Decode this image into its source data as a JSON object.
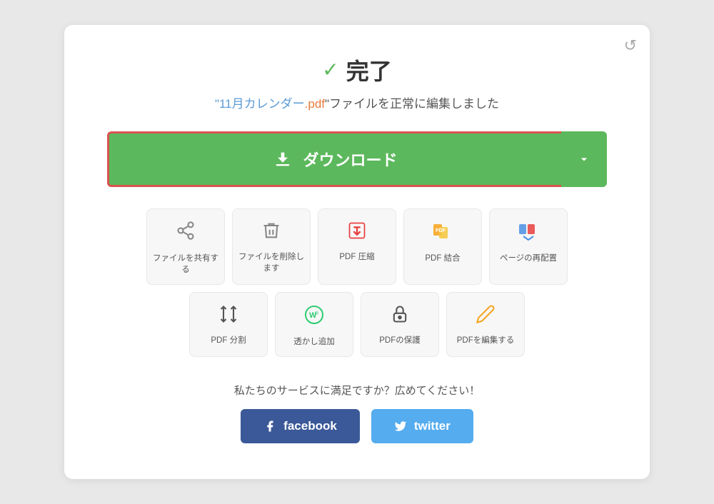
{
  "refresh_icon": "↺",
  "title": {
    "check": "✓",
    "label": "完了",
    "subtitle_prefix": "\"11月カレンダー",
    "subtitle_ext": ".pdf",
    "subtitle_suffix": "\"ファイルを正常に編集しました"
  },
  "download_button": {
    "label": "ダウンロード",
    "chevron": "∨"
  },
  "tools": [
    {
      "icon_type": "share",
      "label": "ファイルを共有する"
    },
    {
      "icon_type": "delete",
      "label": "ファイルを削除します"
    },
    {
      "icon_type": "compress",
      "label": "PDF 圧縮"
    },
    {
      "icon_type": "merge",
      "label": "PDF 結合"
    },
    {
      "icon_type": "rearrange",
      "label": "ページの再配置"
    },
    {
      "icon_type": "split",
      "label": "PDF 分割"
    },
    {
      "icon_type": "watermark",
      "label": "透かし追加"
    },
    {
      "icon_type": "protect",
      "label": "PDFの保護"
    },
    {
      "icon_type": "edit",
      "label": "PDFを編集する"
    }
  ],
  "share": {
    "text": "私たちのサービスに満足ですか？広めてください！",
    "facebook_label": "facebook",
    "twitter_label": "twitter"
  }
}
